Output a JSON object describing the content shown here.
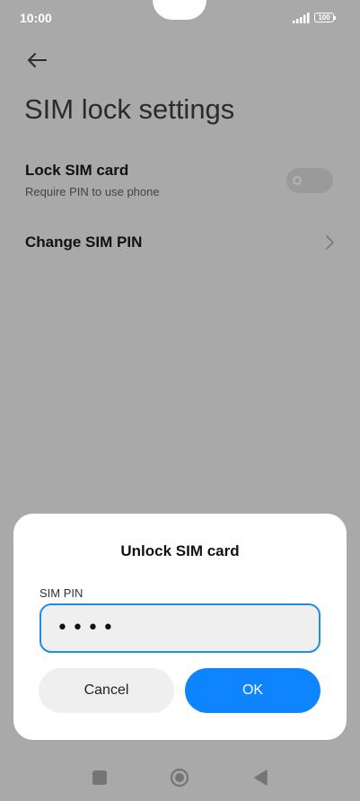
{
  "status_bar": {
    "time": "10:00",
    "battery": "100"
  },
  "page": {
    "title": "SIM lock settings"
  },
  "lock_sim": {
    "title": "Lock SIM card",
    "subtitle": "Require PIN to use phone",
    "enabled": false
  },
  "change_pin": {
    "title": "Change SIM PIN"
  },
  "dialog": {
    "title": "Unlock SIM card",
    "field_label": "SIM PIN",
    "pin_value": "••••",
    "cancel_label": "Cancel",
    "ok_label": "OK"
  },
  "colors": {
    "accent": "#0e84ff",
    "input_border": "#1f8ce6",
    "scrim": "#a9a9a9"
  },
  "icons": {
    "back": "arrow-left-icon",
    "chevron": "chevron-right-icon",
    "signal": "signal-icon",
    "battery": "battery-icon",
    "nav_recents": "square-icon",
    "nav_home": "circle-icon",
    "nav_back": "triangle-icon"
  }
}
